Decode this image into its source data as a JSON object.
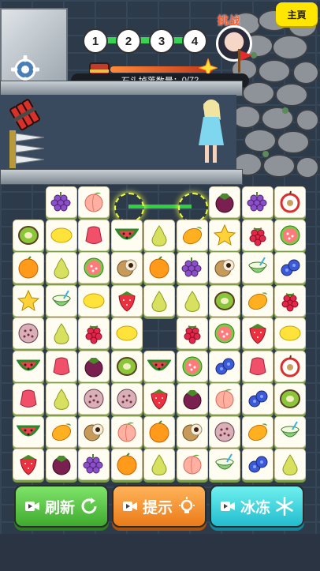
{
  "top": {
    "home_label": "主頁",
    "challenge_label": "挑战",
    "levels": [
      "1",
      "2",
      "3",
      "4"
    ],
    "drop_label": "石头掉落数量：",
    "drop_value": "0/72"
  },
  "board": {
    "cols": 9,
    "rows": 9,
    "tiles": [
      [
        null,
        "grape",
        "peach",
        null,
        null,
        null,
        "mangosteen",
        "grape",
        "apple"
      ],
      [
        "kiwi",
        "lemon",
        "waxapple",
        "watermelon",
        "pear",
        "mango",
        "starfruit",
        "raspberry",
        "guava"
      ],
      [
        "orange",
        "pear",
        "guava",
        "longan",
        "orange",
        "grape",
        "longan",
        "coconut",
        "blueberry"
      ],
      [
        "starfruit",
        "coconut",
        "lemon",
        "strawberry",
        "pear",
        "pear",
        "kiwi",
        "mango",
        "raspberry"
      ],
      [
        "passionfruit",
        "pear",
        "raspberry",
        "lemon",
        null,
        "raspberry",
        "guava",
        "strawberry",
        "lemon"
      ],
      [
        "watermelon",
        "waxapple",
        "mangosteen",
        "kiwi",
        "watermelon",
        "guava",
        "blueberry",
        "waxapple",
        "apple"
      ],
      [
        "waxapple",
        "pear",
        "passionfruit",
        "passionfruit",
        "strawberry",
        "mangosteen",
        "peach",
        "blueberry",
        "kiwi"
      ],
      [
        "watermelon",
        "mango",
        "longan",
        "peach",
        "orange",
        "longan",
        "passionfruit",
        "mango",
        "coconut"
      ],
      [
        "strawberry",
        "mangosteen",
        "grape",
        "orange",
        "pear",
        "peach",
        "coconut",
        "blueberry",
        "pear"
      ]
    ]
  },
  "buttons": {
    "refresh_label": "刷新",
    "hint_label": "提示",
    "freeze_label": "冰冻"
  },
  "colors": {
    "refresh": "#4cbc3a",
    "hint": "#f29430",
    "freeze": "#35c9d8",
    "link": "#2fd040"
  },
  "icons": [
    "gear-icon",
    "video-icon",
    "refresh-icon",
    "lightbulb-icon",
    "snowflake-icon",
    "flag-icon",
    "dynamite-icon"
  ]
}
